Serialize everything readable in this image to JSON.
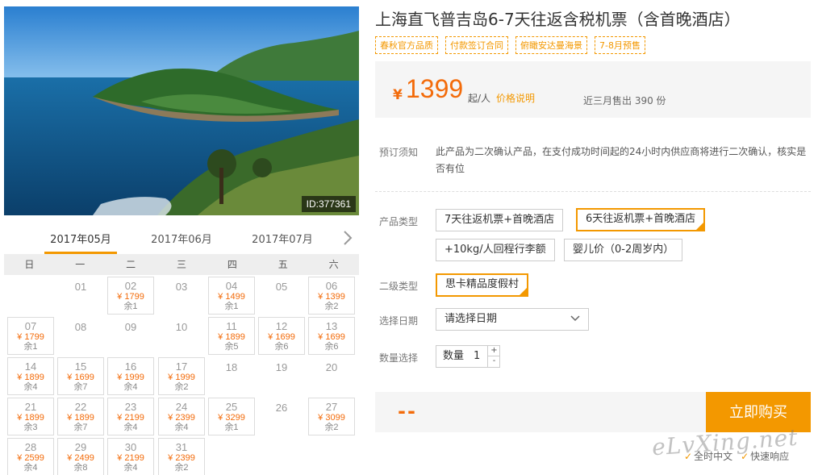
{
  "photo": {
    "id_label": "ID:377361"
  },
  "calendar": {
    "tabs": [
      "2017年05月",
      "2017年06月",
      "2017年07月"
    ],
    "weekdays": [
      "日",
      "一",
      "二",
      "三",
      "四",
      "五",
      "六"
    ],
    "weeks": [
      [
        null,
        {
          "day": "01"
        },
        {
          "day": "02",
          "price": "¥ 1799",
          "left": "余1"
        },
        {
          "day": "03"
        },
        {
          "day": "04",
          "price": "¥ 1499",
          "left": "余1"
        },
        {
          "day": "05"
        },
        {
          "day": "06",
          "price": "¥ 1399",
          "left": "余2"
        }
      ],
      [
        {
          "day": "07",
          "price": "¥ 1799",
          "left": "余1"
        },
        {
          "day": "08"
        },
        {
          "day": "09"
        },
        {
          "day": "10"
        },
        {
          "day": "11",
          "price": "¥ 1899",
          "left": "余5"
        },
        {
          "day": "12",
          "price": "¥ 1699",
          "left": "余6"
        },
        {
          "day": "13",
          "price": "¥ 1699",
          "left": "余6"
        }
      ],
      [
        {
          "day": "14",
          "price": "¥ 1899",
          "left": "余4"
        },
        {
          "day": "15",
          "price": "¥ 1699",
          "left": "余7"
        },
        {
          "day": "16",
          "price": "¥ 1999",
          "left": "余4"
        },
        {
          "day": "17",
          "price": "¥ 1999",
          "left": "余2"
        },
        {
          "day": "18"
        },
        {
          "day": "19"
        },
        {
          "day": "20"
        }
      ],
      [
        {
          "day": "21",
          "price": "¥ 1899",
          "left": "余3"
        },
        {
          "day": "22",
          "price": "¥ 1899",
          "left": "余7"
        },
        {
          "day": "23",
          "price": "¥ 2199",
          "left": "余4"
        },
        {
          "day": "24",
          "price": "¥ 2399",
          "left": "余4"
        },
        {
          "day": "25",
          "price": "¥ 3299",
          "left": "余1"
        },
        {
          "day": "26"
        },
        {
          "day": "27",
          "price": "¥ 3099",
          "left": "余2"
        }
      ],
      [
        {
          "day": "28",
          "price": "¥ 2599",
          "left": "余4"
        },
        {
          "day": "29",
          "price": "¥ 2499",
          "left": "余8"
        },
        {
          "day": "30",
          "price": "¥ 2199",
          "left": "余4"
        },
        {
          "day": "31",
          "price": "¥ 2399",
          "left": "余2"
        },
        null,
        null,
        null
      ]
    ]
  },
  "product": {
    "title": "上海直飞普吉岛6-7天往返含税机票（含首晚酒店）",
    "tags": [
      "春秋官方品质",
      "付款签订合同",
      "俯瞰安达曼海景",
      "7-8月预售"
    ],
    "price": {
      "currency": "¥",
      "amount": "1399",
      "unit": "起/人",
      "note": "价格说明",
      "sold": "近三月售出 390 份"
    },
    "notice_label": "预订须知",
    "notice_text": "此产品为二次确认产品，在支付成功时间起的24小时内供应商将进行二次确认，核实是否有位",
    "type_label": "产品类型",
    "type_options": [
      "7天往返机票+首晚酒店",
      "6天往返机票+首晚酒店",
      "+10kg/人回程行李额",
      "婴儿价（0-2周岁内）"
    ],
    "subtype_label": "二级类型",
    "subtype_options": [
      "思卡精品度假村"
    ],
    "date_label": "选择日期",
    "date_placeholder": "请选择日期",
    "qty_label": "数量选择",
    "qty_prefix": "数量",
    "qty_value": "1",
    "qty_plus": "+",
    "qty_minus": "-",
    "total_placeholder": "--",
    "buy_label": "立即购买",
    "badges": [
      "全时中文",
      "快速响应"
    ],
    "watermark": "eLvXing.net"
  },
  "colors": {
    "accent": "#f39800",
    "price": "#f36b0a"
  }
}
